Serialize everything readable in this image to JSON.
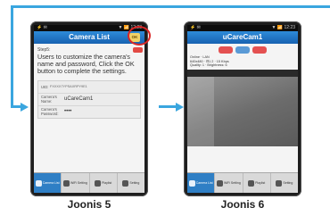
{
  "phone5": {
    "status": {
      "left": "⚡ ✉",
      "right": "▼ 📶 12:23"
    },
    "title": "Camera List",
    "ok_button": "OK",
    "red_badge": "",
    "step_label": "Step5:",
    "instructions": "Users to customize the camera's name and password, Click the OK button to complete the settings.",
    "fields": [
      {
        "label": "UID:",
        "value": "FXXXX7YPSAXRPY9E1"
      },
      {
        "label": "Camera's Name:",
        "value": "uCareCam1"
      },
      {
        "label": "Camera's Password:",
        "value": "••••"
      }
    ],
    "toolbar": [
      {
        "label": "Camera List",
        "icon": "camera-list-icon"
      },
      {
        "label": "WiFi Setting",
        "icon": "wifi-icon"
      },
      {
        "label": "Playlist",
        "icon": "playlist-icon"
      },
      {
        "label": "Setting",
        "icon": "gear-icon"
      }
    ]
  },
  "phone6": {
    "status": {
      "left": "⚡ ✉",
      "right": "▼ 📶 12:23"
    },
    "title": "uCareCam1",
    "info_lines": [
      "Online · LAN",
      "640x480 · ⊟1  2  ·  15 Kbps",
      "Quality: 1  ·  Brightness: 6"
    ],
    "toolbar": [
      {
        "label": "Camera List",
        "icon": "camera-list-icon"
      },
      {
        "label": "WiFi Setting",
        "icon": "wifi-icon"
      },
      {
        "label": "Playlist",
        "icon": "playlist-icon"
      },
      {
        "label": "Setting",
        "icon": "gear-icon"
      }
    ]
  },
  "captions": {
    "left": "Joonis 5",
    "right": "Joonis 6"
  },
  "colors": {
    "accent": "#3aa6df",
    "title_bar": "#1f72c4",
    "highlight_ring": "#d92525"
  }
}
